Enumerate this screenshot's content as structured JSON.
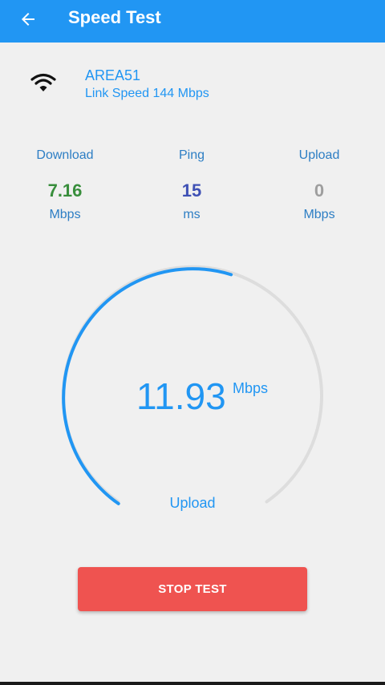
{
  "appbar": {
    "title": "Speed Test",
    "back_icon": "arrow-left-icon",
    "color": "#2196f3"
  },
  "network": {
    "icon": "wifi-icon",
    "ssid": "AREA51",
    "link_speed": "Link Speed 144 Mbps"
  },
  "metrics": [
    {
      "label": "Download",
      "value": "7.16",
      "unit": "Mbps",
      "color": "#388e3c"
    },
    {
      "label": "Ping",
      "value": "15",
      "unit": "ms",
      "color": "#3f51b5"
    },
    {
      "label": "Upload",
      "value": "0",
      "unit": "Mbps",
      "color": "#9e9e9e"
    }
  ],
  "gauge": {
    "value": "11.93",
    "unit": "Mbps",
    "label": "Upload",
    "progress_fraction": 0.56,
    "active_color": "#2196f3",
    "track_color": "#dddddd"
  },
  "actions": {
    "stop_label": "STOP TEST",
    "stop_color": "#ef5350"
  }
}
